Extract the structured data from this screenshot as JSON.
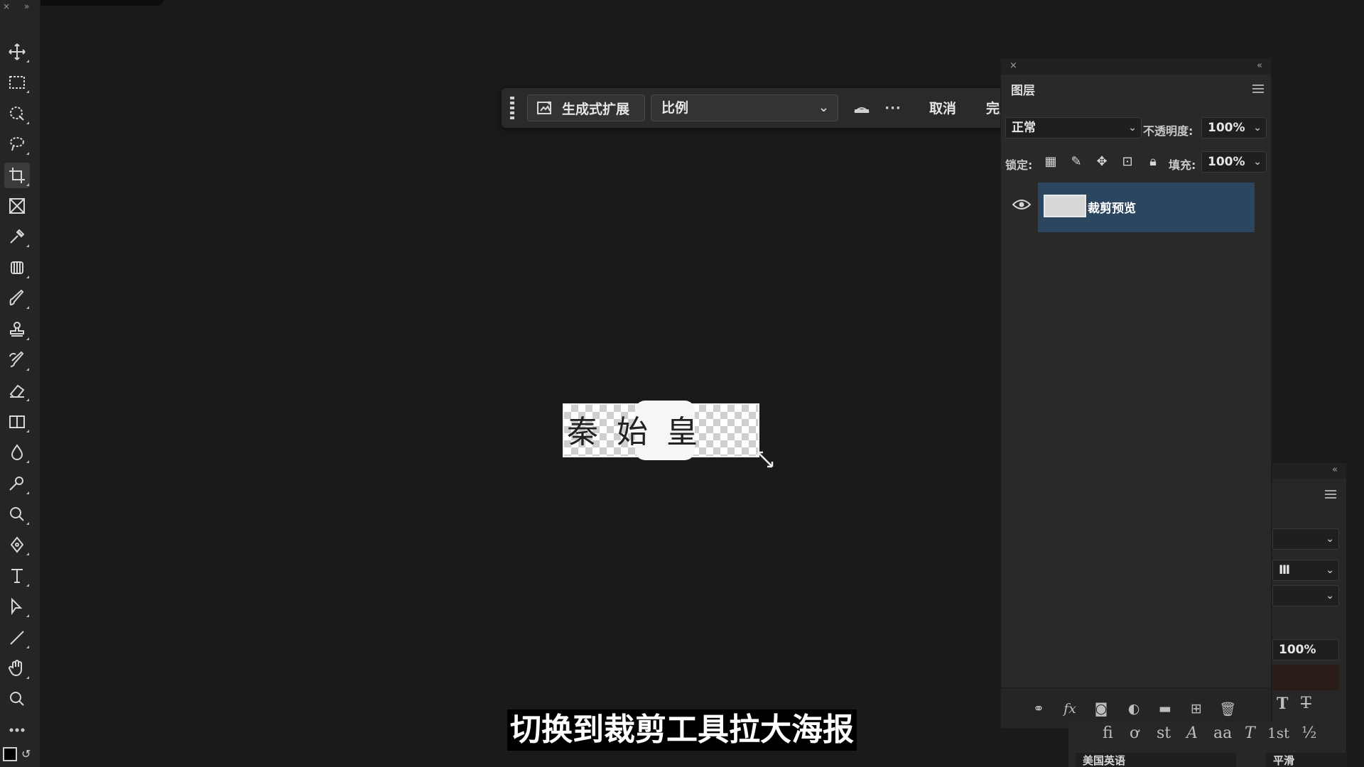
{
  "toolbar": {
    "tools": [
      {
        "name": "move-tool",
        "icon": "move-icon"
      },
      {
        "name": "marquee-tool",
        "icon": "rect-marquee-icon"
      },
      {
        "name": "object-select-tool",
        "icon": "object-select-icon"
      },
      {
        "name": "lasso-tool",
        "icon": "lasso-icon"
      },
      {
        "name": "crop-tool",
        "icon": "crop-icon",
        "active": true
      },
      {
        "name": "frame-tool",
        "icon": "frame-icon"
      },
      {
        "name": "eyedropper-tool",
        "icon": "eyedropper-icon"
      },
      {
        "name": "healing-tool",
        "icon": "healing-brush-icon"
      },
      {
        "name": "brush-tool",
        "icon": "brush-icon"
      },
      {
        "name": "stamp-tool",
        "icon": "clone-stamp-icon"
      },
      {
        "name": "history-brush-tool",
        "icon": "history-brush-icon"
      },
      {
        "name": "eraser-tool",
        "icon": "eraser-icon"
      },
      {
        "name": "gradient-tool",
        "icon": "gradient-icon"
      },
      {
        "name": "blur-tool",
        "icon": "blur-drop-icon"
      },
      {
        "name": "dodge-tool",
        "icon": "dodge-icon"
      },
      {
        "name": "zoom-lens-tool",
        "icon": "magnifier-icon"
      },
      {
        "name": "pen-tool",
        "icon": "pen-icon"
      },
      {
        "name": "type-tool",
        "icon": "type-icon"
      },
      {
        "name": "path-select-tool",
        "icon": "arrow-select-icon"
      },
      {
        "name": "line-tool",
        "icon": "line-icon"
      },
      {
        "name": "hand-tool",
        "icon": "hand-icon"
      },
      {
        "name": "zoom-tool",
        "icon": "zoom-icon"
      },
      {
        "name": "more-tools",
        "icon": "more-icon"
      }
    ]
  },
  "taskbar": {
    "generative_expand_label": "生成式扩展",
    "ratio_value": "比例",
    "more_icon": "···",
    "cancel_label": "取消",
    "done_label": "完成"
  },
  "canvas": {
    "doc_text": "秦 始 皇"
  },
  "layers": {
    "title": "图层",
    "blend_mode": "正常",
    "opacity_label": "不透明度:",
    "opacity_value": "100%",
    "lock_label": "锁定:",
    "fill_label": "填充:",
    "fill_value": "100%",
    "layer_name": "裁剪预览"
  },
  "char_panel": {
    "partial_select": "Ⅲ",
    "percent_value": "100%",
    "glyphs": [
      "fi",
      "ơ",
      "st",
      "A",
      "aa",
      "T",
      "1st",
      "½"
    ],
    "language": "美国英语",
    "antialias": "平滑"
  },
  "subtitle": "切换到裁剪工具拉大海报",
  "colors": {
    "background": "#1a1a1a",
    "panel": "#292929",
    "selected_layer": "#2c4660",
    "color_swatch": "#2a1d17"
  }
}
